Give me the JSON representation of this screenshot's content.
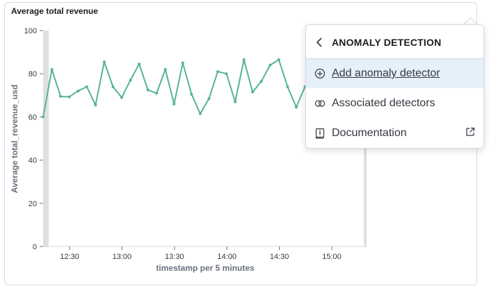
{
  "panel": {
    "title": "Average total revenue"
  },
  "popover": {
    "title": "ANOMALY DETECTION",
    "items": [
      {
        "label": "Add anomaly detector",
        "icon": "plus-in-circle-icon",
        "active": true
      },
      {
        "label": "Associated detectors",
        "icon": "link-circles-icon"
      },
      {
        "label": "Documentation",
        "icon": "documentation-icon",
        "external": true
      }
    ]
  },
  "colors": {
    "series": "#54b399",
    "axis": "#69707d",
    "grid": "#d3dae6"
  },
  "chart_data": {
    "type": "line",
    "title": "Average total revenue",
    "xlabel": "timestamp per 5 minutes",
    "ylabel": "Average total_revenue_usd",
    "ylim": [
      0,
      100
    ],
    "yticks": [
      "0",
      "20",
      "40",
      "60",
      "80",
      "100"
    ],
    "xticks": [
      "12:30",
      "13:00",
      "13:30",
      "14:00",
      "14:30",
      "15:00"
    ],
    "series": [
      {
        "values": [
          60,
          82,
          69.5,
          69.3,
          72,
          74,
          65.5,
          85.5,
          74,
          69,
          77,
          84.5,
          72.5,
          71,
          82,
          66,
          85,
          70.5,
          61.5,
          68.5,
          81,
          80,
          67,
          86.5,
          71.5,
          76.5,
          84,
          86.5,
          74,
          64.5,
          74
        ]
      }
    ]
  }
}
